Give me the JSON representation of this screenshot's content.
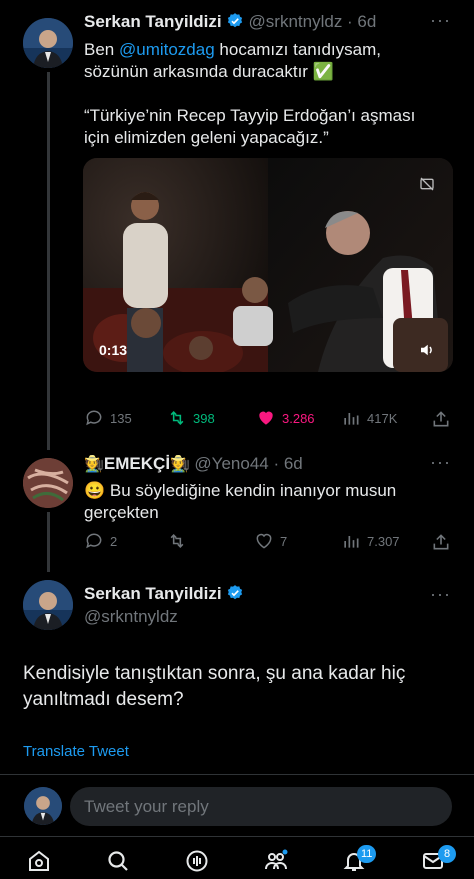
{
  "tweet1": {
    "author_name": "Serkan Tanyildizi",
    "handle_time": "@srkntnyldz · 6d",
    "text_prefix": "Ben ",
    "mention": "@umitozdag",
    "text_line1_rest": " hocamızı tanıdıysam,",
    "text_line2": "sözünün arkasında duracaktır ✅",
    "quote_line1": "“Türkiye’nin Recep Tayyip Erdoğan’ı aşması",
    "quote_line2": "için elimizden geleni yapacağız.”",
    "video_time": "0:13",
    "stats": {
      "replies": "135",
      "retweets": "398",
      "likes": "3.286",
      "views": "417K"
    }
  },
  "tweet2": {
    "author_name": "EMEKÇİ",
    "author_emoji": "🧑‍🌾",
    "handle_time": "@Yeno44 · 6d",
    "text_emoji": "😀",
    "text_line1": "Bu söylediğine kendin inanıyor musun",
    "text_line2": "gerçekten",
    "stats": {
      "replies": "2",
      "retweets": "",
      "likes": "7",
      "views": "7.307"
    }
  },
  "main_tweet": {
    "author_name": "Serkan Tanyildizi",
    "handle": "@srkntnyldz",
    "text_line1": "Kendisiyle tanıştıktan sonra, şu ana kadar hiç",
    "text_line2": "yanıltmadı desem?",
    "translate": "Translate Tweet"
  },
  "reply_placeholder": "Tweet your reply",
  "nav": {
    "communities_badge": "",
    "notifications_badge": "11",
    "messages_badge": "8"
  },
  "colors": {
    "accent": "#1d9bf0",
    "retweet": "#00ba7c",
    "like": "#f91880",
    "muted": "#71767b"
  },
  "icons": [
    "verified-icon",
    "more-icon",
    "reply-icon",
    "retweet-icon",
    "like-icon",
    "views-icon",
    "share-icon",
    "home-icon",
    "search-icon",
    "spaces-icon",
    "communities-icon",
    "notifications-icon",
    "messages-icon",
    "volume-icon",
    "sensitive-icon"
  ]
}
